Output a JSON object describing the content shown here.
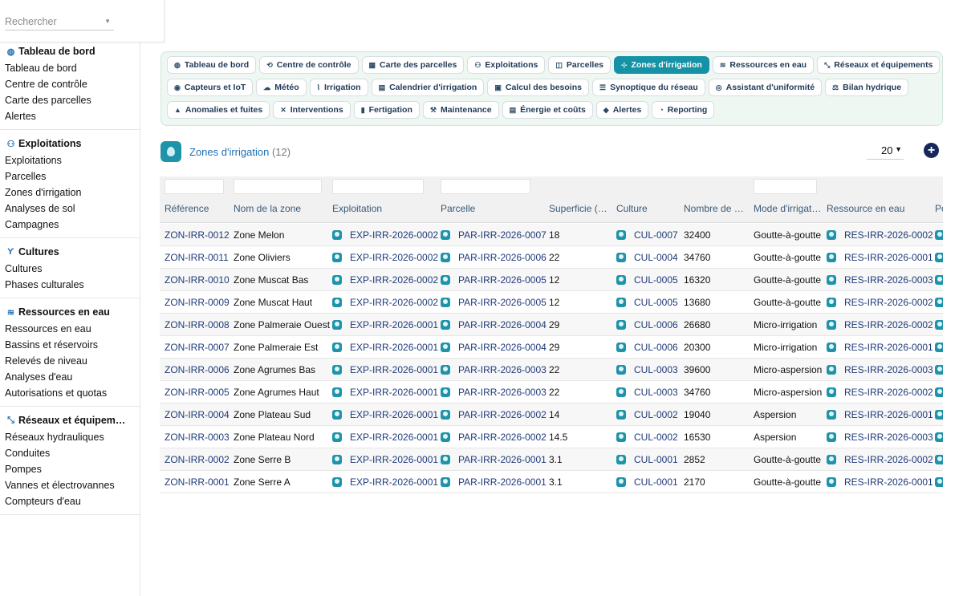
{
  "search": {
    "placeholder": "Rechercher"
  },
  "sidebar": {
    "sections": [
      {
        "title": "Tableau de bord",
        "icon": "dashboard-icon",
        "items": [
          "Tableau de bord",
          "Centre de contrôle",
          "Carte des parcelles",
          "Alertes"
        ]
      },
      {
        "title": "Exploitations",
        "icon": "farm-icon",
        "items": [
          "Exploitations",
          "Parcelles",
          "Zones d'irrigation",
          "Analyses de sol",
          "Campagnes"
        ]
      },
      {
        "title": "Cultures",
        "icon": "sprout-icon",
        "items": [
          "Cultures",
          "Phases culturales"
        ]
      },
      {
        "title": "Ressources en eau",
        "icon": "water-icon",
        "items": [
          "Ressources en eau",
          "Bassins et réservoirs",
          "Relevés de niveau",
          "Analyses d'eau",
          "Autorisations et quotas"
        ]
      },
      {
        "title": "Réseaux et équipem…",
        "icon": "network-icon",
        "items": [
          "Réseaux hydrauliques",
          "Conduites",
          "Pompes",
          "Vannes et électrovannes",
          "Compteurs d'eau"
        ]
      }
    ]
  },
  "tabs": {
    "rows": [
      [
        {
          "label": "Tableau de bord",
          "icon": "◍"
        },
        {
          "label": "Centre de contrôle",
          "icon": "⟲"
        },
        {
          "label": "Carte des parcelles",
          "icon": "▦"
        },
        {
          "label": "Exploitations",
          "icon": "⚇"
        },
        {
          "label": "Parcelles",
          "icon": "◫"
        },
        {
          "label": "Zones d'irrigation",
          "icon": "⊹",
          "active": true
        },
        {
          "label": "Ressources en eau",
          "icon": "≋"
        },
        {
          "label": "Réseaux et équipements",
          "icon": "⤡"
        }
      ],
      [
        {
          "label": "Capteurs et IoT",
          "icon": "◉"
        },
        {
          "label": "Météo",
          "icon": "☁"
        },
        {
          "label": "Irrigation",
          "icon": "⌇"
        },
        {
          "label": "Calendrier d'irrigation",
          "icon": "▤"
        },
        {
          "label": "Calcul des besoins",
          "icon": "▣"
        },
        {
          "label": "Synoptique du réseau",
          "icon": "☰"
        },
        {
          "label": "Assistant d'uniformité",
          "icon": "◎"
        },
        {
          "label": "Bilan hydrique",
          "icon": "⚖"
        }
      ],
      [
        {
          "label": "Anomalies et fuites",
          "icon": "▲"
        },
        {
          "label": "Interventions",
          "icon": "✕"
        },
        {
          "label": "Fertigation",
          "icon": "▮"
        },
        {
          "label": "Maintenance",
          "icon": "⚒"
        },
        {
          "label": "Énergie et coûts",
          "icon": "▤"
        },
        {
          "label": "Alertes",
          "icon": "◆"
        },
        {
          "label": "Reporting",
          "icon": "◔"
        }
      ]
    ]
  },
  "list": {
    "title": "Zones d'irrigation",
    "count": "(12)",
    "page_size": "20",
    "add_label": "+"
  },
  "grid": {
    "columns": [
      "Référence",
      "Nom de la zone",
      "Exploitation",
      "Parcelle",
      "Superficie (ha)",
      "Culture",
      "Nombre de p…",
      "Mode d'irrigat…",
      "Ressource en eau",
      "Po"
    ],
    "rows": [
      [
        "ZON-IRR-0012",
        "Zone Melon",
        "EXP-IRR-2026-0002",
        "PAR-IRR-2026-0007",
        "18",
        "CUL-0007",
        "32400",
        "Goutte-à-goutte",
        "RES-IRR-2026-0002"
      ],
      [
        "ZON-IRR-0011",
        "Zone Oliviers",
        "EXP-IRR-2026-0002",
        "PAR-IRR-2026-0006",
        "22",
        "CUL-0004",
        "34760",
        "Goutte-à-goutte",
        "RES-IRR-2026-0001"
      ],
      [
        "ZON-IRR-0010",
        "Zone Muscat Bas",
        "EXP-IRR-2026-0002",
        "PAR-IRR-2026-0005",
        "12",
        "CUL-0005",
        "16320",
        "Goutte-à-goutte",
        "RES-IRR-2026-0003"
      ],
      [
        "ZON-IRR-0009",
        "Zone Muscat Haut",
        "EXP-IRR-2026-0002",
        "PAR-IRR-2026-0005",
        "12",
        "CUL-0005",
        "13680",
        "Goutte-à-goutte",
        "RES-IRR-2026-0002"
      ],
      [
        "ZON-IRR-0008",
        "Zone Palmeraie Ouest",
        "EXP-IRR-2026-0001",
        "PAR-IRR-2026-0004",
        "29",
        "CUL-0006",
        "26680",
        "Micro-irrigation",
        "RES-IRR-2026-0002"
      ],
      [
        "ZON-IRR-0007",
        "Zone Palmeraie Est",
        "EXP-IRR-2026-0001",
        "PAR-IRR-2026-0004",
        "29",
        "CUL-0006",
        "20300",
        "Micro-irrigation",
        "RES-IRR-2026-0001"
      ],
      [
        "ZON-IRR-0006",
        "Zone Agrumes Bas",
        "EXP-IRR-2026-0001",
        "PAR-IRR-2026-0003",
        "22",
        "CUL-0003",
        "39600",
        "Micro-aspersion",
        "RES-IRR-2026-0003"
      ],
      [
        "ZON-IRR-0005",
        "Zone Agrumes Haut",
        "EXP-IRR-2026-0001",
        "PAR-IRR-2026-0003",
        "22",
        "CUL-0003",
        "34760",
        "Micro-aspersion",
        "RES-IRR-2026-0002"
      ],
      [
        "ZON-IRR-0004",
        "Zone Plateau Sud",
        "EXP-IRR-2026-0001",
        "PAR-IRR-2026-0002",
        "14",
        "CUL-0002",
        "19040",
        "Aspersion",
        "RES-IRR-2026-0001"
      ],
      [
        "ZON-IRR-0003",
        "Zone Plateau Nord",
        "EXP-IRR-2026-0001",
        "PAR-IRR-2026-0002",
        "14.5",
        "CUL-0002",
        "16530",
        "Aspersion",
        "RES-IRR-2026-0003"
      ],
      [
        "ZON-IRR-0002",
        "Zone Serre B",
        "EXP-IRR-2026-0001",
        "PAR-IRR-2026-0001",
        "3.1",
        "CUL-0001",
        "2852",
        "Goutte-à-goutte",
        "RES-IRR-2026-0002"
      ],
      [
        "ZON-IRR-0001",
        "Zone Serre A",
        "EXP-IRR-2026-0001",
        "PAR-IRR-2026-0001",
        "3.1",
        "CUL-0001",
        "2170",
        "Goutte-à-goutte",
        "RES-IRR-2026-0001"
      ]
    ]
  },
  "colors": {
    "accent": "#1592a6",
    "link": "#1f3a7a",
    "brand": "#1e93a9",
    "add_button": "#16285a"
  }
}
